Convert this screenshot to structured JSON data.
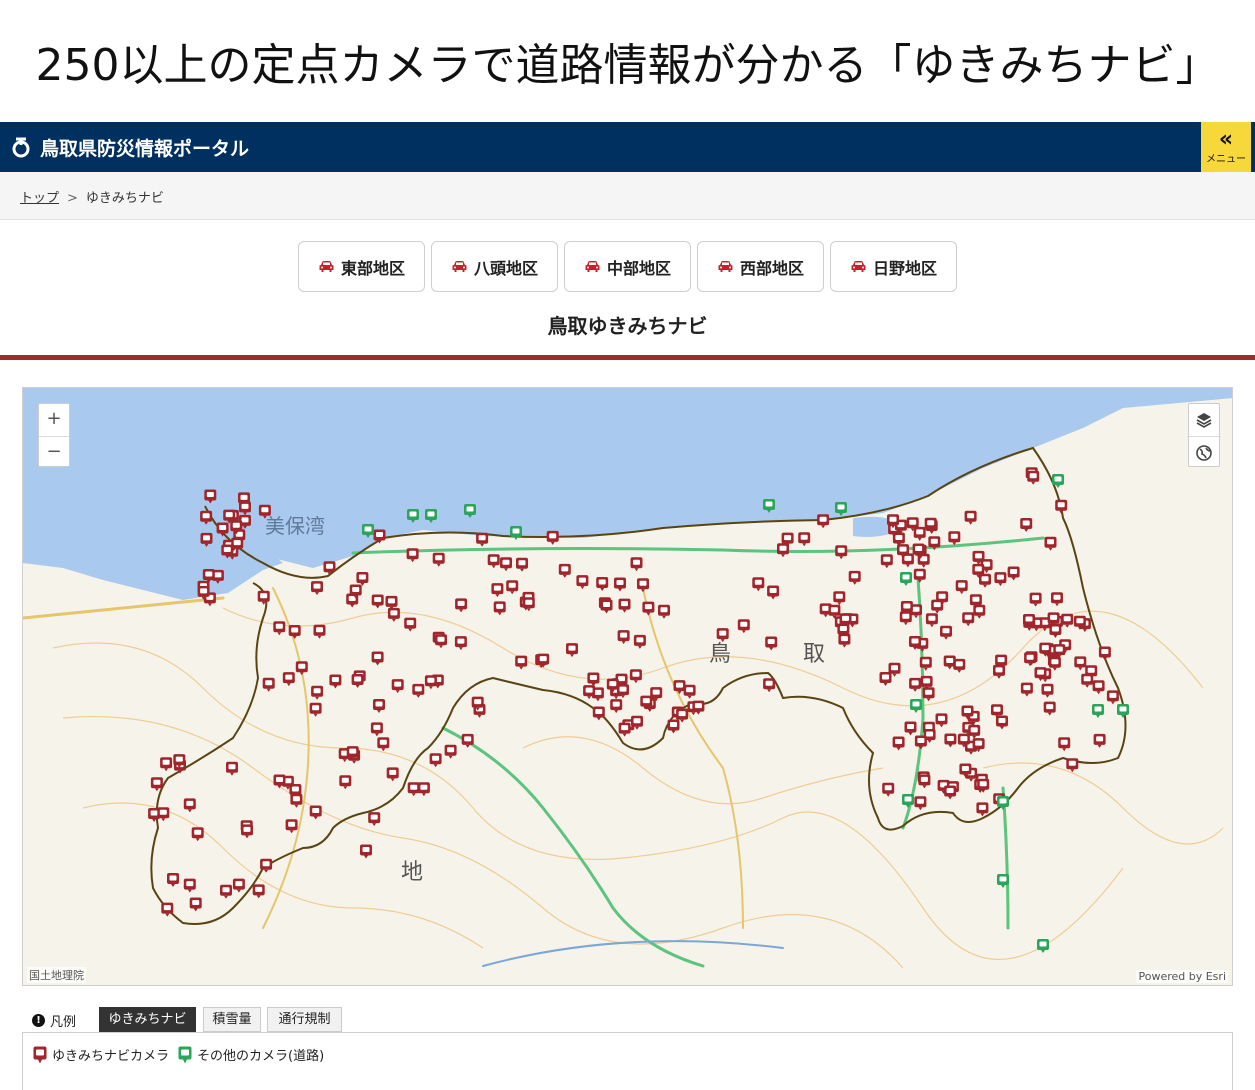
{
  "headline": "250以上の定点カメラで道路情報が分かる「ゆきみちナビ」",
  "portal": {
    "title": "鳥取県防災情報ポータル",
    "menu_label": "メニュー",
    "menu_icon": "double-chevron-left-icon"
  },
  "breadcrumb": {
    "top": "トップ",
    "current": "ゆきみちナビ"
  },
  "districts": [
    "東部地区",
    "八頭地区",
    "中部地区",
    "西部地区",
    "日野地区"
  ],
  "section_title": "鳥取ゆきみちナビ",
  "map": {
    "zoom_in": "+",
    "zoom_out": "−",
    "attribution_left": "国土地理院",
    "attribution_right": "Powered by Esri",
    "labels": {
      "bay": "美保湾",
      "tottori": "鳥",
      "tottori2": "取",
      "chi": "地"
    },
    "colors": {
      "sea": "#a9c9ee",
      "land": "#f6f3ea",
      "camera": "#a0262c",
      "other_camera": "#2aa55a",
      "border": "#5a4412",
      "road": "#5cc47c"
    }
  },
  "legend": {
    "label": "凡例",
    "tabs": [
      "ゆきみちナビ",
      "積雪量",
      "通行規制"
    ],
    "items": [
      "ゆきみちナビカメラ",
      "その他のカメラ(道路)"
    ]
  }
}
